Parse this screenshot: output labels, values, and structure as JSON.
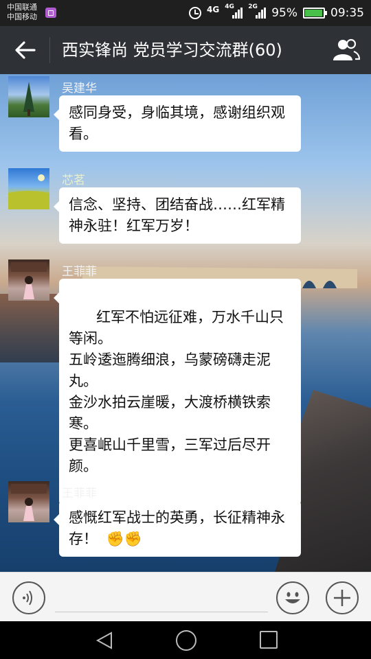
{
  "status_bar": {
    "carrier1": "中国联通",
    "carrier2": "中国移动",
    "net1": "4G",
    "net2": "4G",
    "net3": "2G",
    "battery_percent": "95%",
    "battery_level": 0.95,
    "time": "09:35",
    "icons": [
      "notification-icon",
      "alarm-icon",
      "signal-icon",
      "battery-icon"
    ]
  },
  "header": {
    "title": "西实锋尚  党员学习交流群(60)",
    "back_icon": "back-arrow-icon",
    "members_icon": "group-members-icon"
  },
  "messages": [
    {
      "sender": "吴建华",
      "text": "感同身受，身临其境，感谢组织观看。",
      "avatar": "tree-landscape"
    },
    {
      "sender": "芯茗",
      "text": "信念、坚持、团结奋战……红军精神永驻！红军万岁！",
      "avatar": "rapeseed-field"
    },
    {
      "sender": "王菲菲",
      "text": "红军不怕远征难，万水千山只等闲。\n五岭逶迤腾细浪，乌蒙磅礴走泥丸。\n金沙水拍云崖暖，大渡桥横铁索寒。\n更喜岷山千里雪，三军过后尽开颜。",
      "avatar": "girl-in-room"
    },
    {
      "sender": "王菲菲",
      "text": "感慨红军战士的英勇，长征精神永存！",
      "emoji": "✊✊",
      "avatar": "girl-in-room"
    }
  ],
  "input_bar": {
    "placeholder": "",
    "voice_icon": "voice-icon",
    "emoji_icon": "smiley-icon",
    "more_icon": "plus-icon"
  },
  "navbar": {
    "icons": [
      "nav-back-icon",
      "nav-home-icon",
      "nav-recent-icon"
    ]
  },
  "colors": {
    "header_bg": "#2e3136",
    "status_bg": "#1f1f1f",
    "bubble_bg": "#ffffff",
    "battery_fill": "#49c04a"
  }
}
